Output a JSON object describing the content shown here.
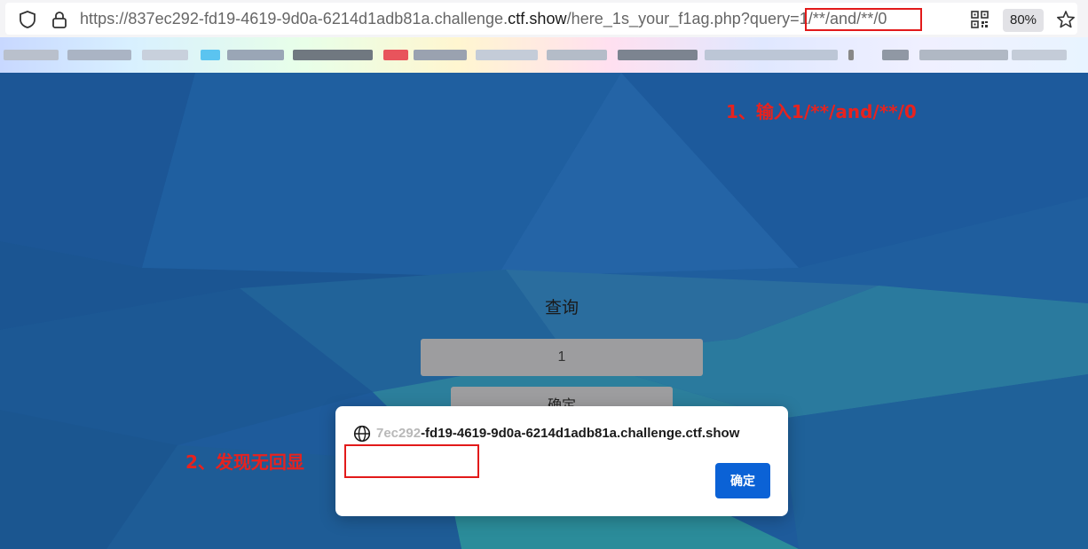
{
  "browser": {
    "url_prefix": "https://837ec292-fd19-4619-9d0a-6214d1adb81a.challenge.",
    "url_domain": "ctf.show",
    "url_suffix": "/here_1s_your_f1ag.php?query=1/**/and/**/0",
    "zoom": "80%",
    "icons": [
      "shield-icon",
      "lock-icon",
      "qr-code-icon",
      "star-icon"
    ]
  },
  "bookmarks_bar": {
    "blurred": true
  },
  "page": {
    "title": "查询",
    "input_value": "1",
    "submit_label": "确定"
  },
  "alert": {
    "origin_faded": "7ec292",
    "origin_rest": "-fd19-4619-9d0a-6214d1adb81a.challenge.ctf.show",
    "message": "",
    "ok_label": "确定"
  },
  "annotations": {
    "step1": "1、输入1/**/and/**/0",
    "step2": "2、发现无回显",
    "color": "#e21a1a"
  },
  "colors": {
    "page_bg": "#1d5a9a",
    "dialog_button": "#0b62d6"
  }
}
